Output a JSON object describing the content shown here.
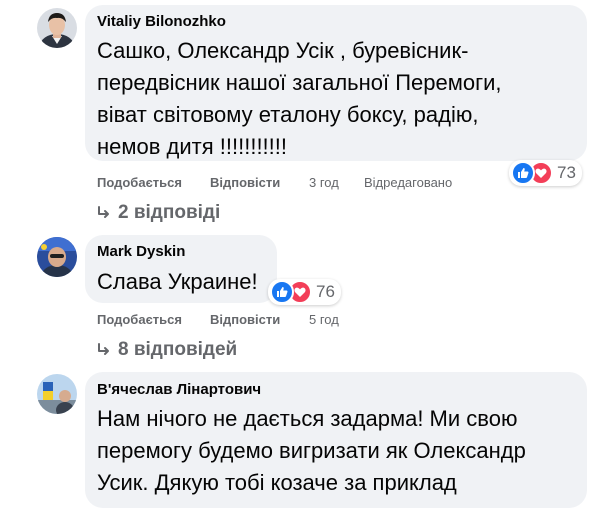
{
  "comments": [
    {
      "author": "Vitaliy Bilonozhko",
      "lines": [
        "Сашко, Олександр Усік , буревісник-",
        "передвісник нашої загальної Перемоги,",
        "віват світовому еталону боксу, радію,",
        "немов дитя !!!!!!!!!!!"
      ],
      "reaction_count": "73",
      "like_label": "Подобається",
      "reply_label": "Відповісти",
      "time": "3 год",
      "edited": "Відредаговано",
      "replies": "2 відповіді"
    },
    {
      "author": "Mark Dyskin",
      "lines": [
        "Слава Украине!"
      ],
      "reaction_count": "76",
      "like_label": "Подобається",
      "reply_label": "Відповісти",
      "time": "5 год",
      "replies": "8 відповідей"
    },
    {
      "author": "В'ячеслав Лінартович",
      "lines": [
        "Нам нічого не дається задарма! Ми свою",
        "перемогу будемо вигризати як Олександр",
        "Усик. Дякую тобі козаче за приклад"
      ]
    }
  ],
  "colors": {
    "bubble": "#f0f2f5",
    "meta_text": "#65676b",
    "like_blue": "#1877f2",
    "love_red": "#f33e58"
  }
}
